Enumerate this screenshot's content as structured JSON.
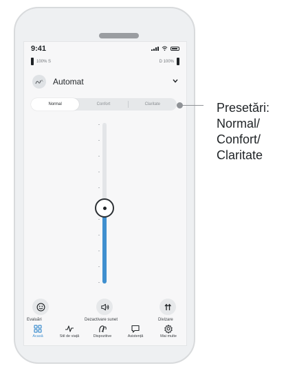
{
  "status": {
    "time": "9:41"
  },
  "hearing_aids": {
    "left": {
      "text": "100% S",
      "level": 1.0
    },
    "right": {
      "text": "D 100%",
      "level": 1.0
    }
  },
  "program": {
    "name": "Automat"
  },
  "presets": {
    "items": [
      "Normal",
      "Confort",
      "Claritate"
    ],
    "selected": "Normal"
  },
  "volume": {
    "level": 0.47
  },
  "actions": {
    "ratings": "Evaluări",
    "mute": "Dezactivare sunet",
    "split": "Divizare"
  },
  "tabs": [
    {
      "label": "Acasă",
      "icon": "home-grid-icon",
      "active": true
    },
    {
      "label": "Stil de viață",
      "icon": "activity-icon",
      "active": false
    },
    {
      "label": "Dispozitive",
      "icon": "hearing-aid-icon",
      "active": false
    },
    {
      "label": "Asistență",
      "icon": "chat-bubble-icon",
      "active": false
    },
    {
      "label": "Mai multe",
      "icon": "gear-icon",
      "active": false
    }
  ],
  "callout": {
    "lines": [
      "Presetări:",
      "Normal/",
      "Confort/",
      "Claritate"
    ]
  },
  "colors": {
    "accent": "#3f8fcf",
    "text": "#1f2326",
    "track": "#e3e5e8"
  }
}
